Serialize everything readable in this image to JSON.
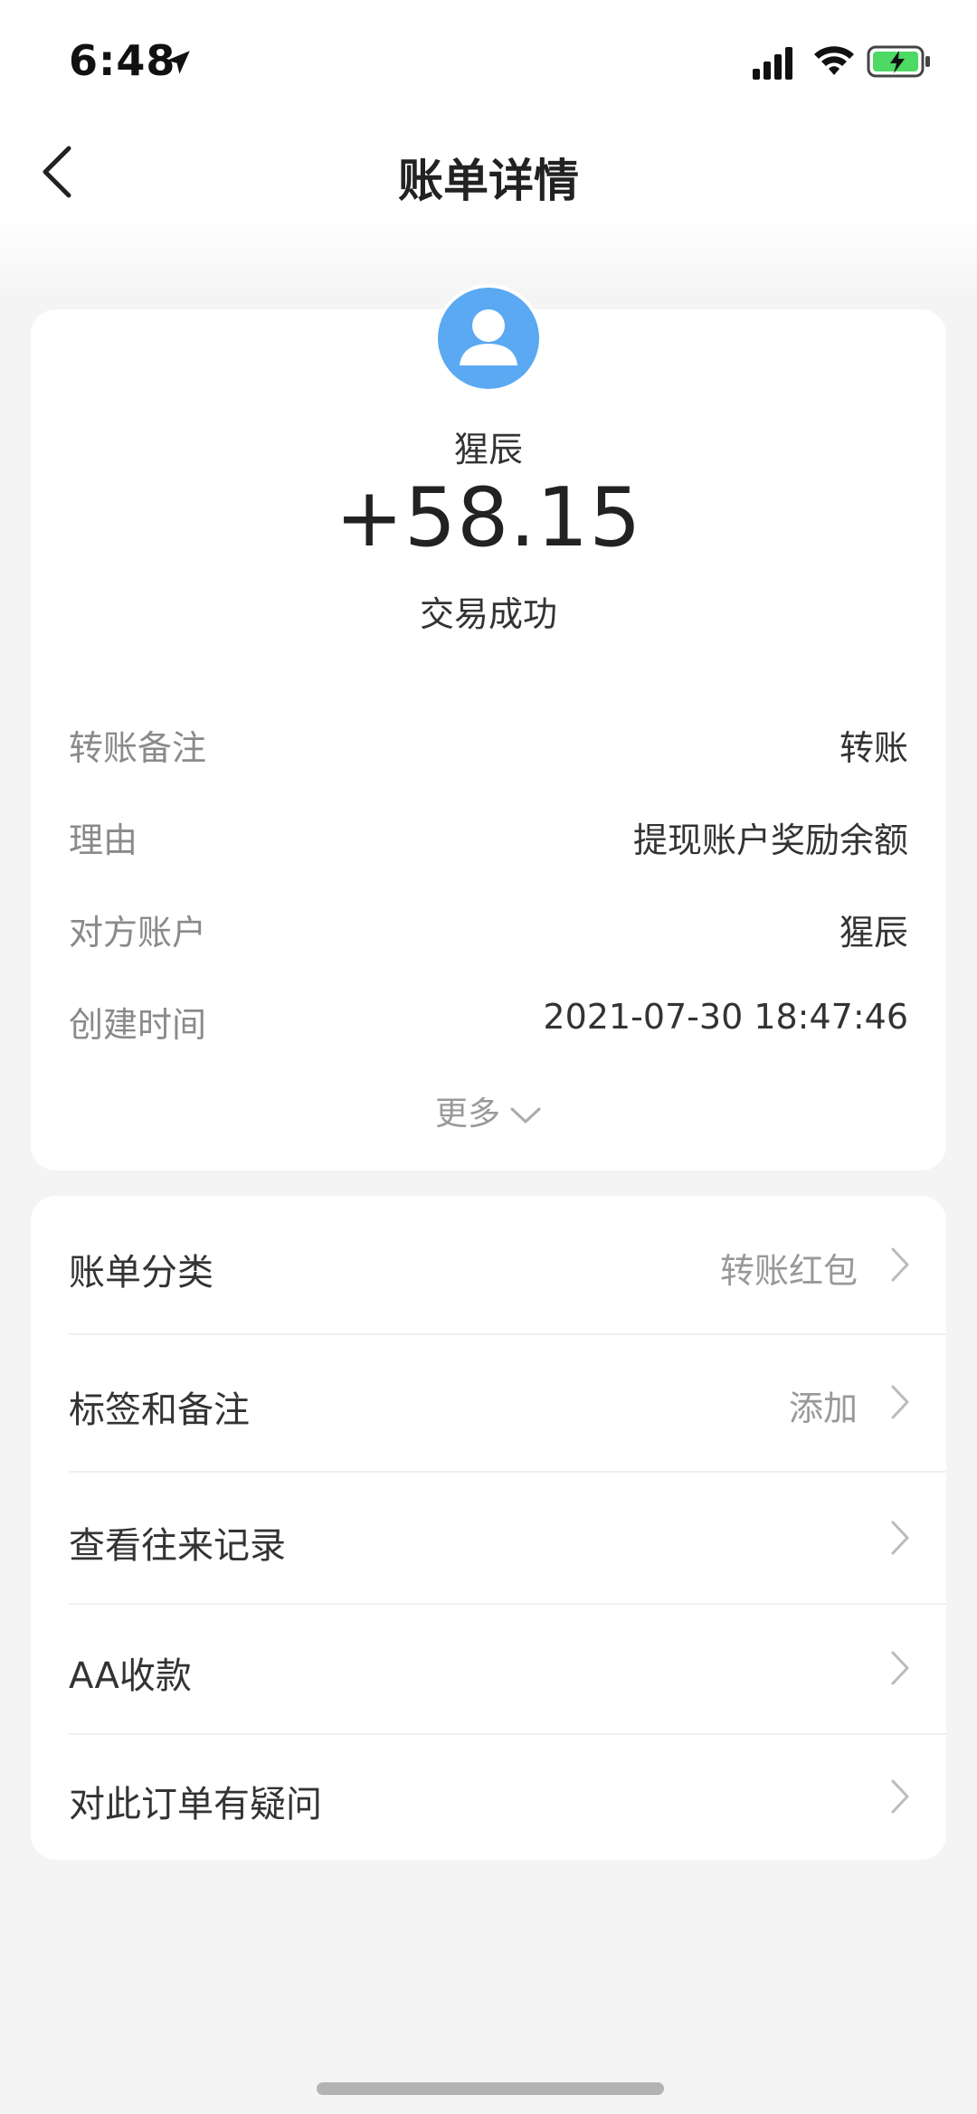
{
  "status_bar": {
    "time": "6:48"
  },
  "nav": {
    "title": "账单详情"
  },
  "transaction": {
    "payer_name": "猩辰",
    "amount": "+58.15",
    "status": "交易成功"
  },
  "details": [
    {
      "label": "转账备注",
      "value": "转账"
    },
    {
      "label": "理由",
      "value": "提现账户奖励余额"
    },
    {
      "label": "对方账户",
      "value": "猩辰"
    },
    {
      "label": "创建时间",
      "value": "2021-07-30 18:47:46"
    }
  ],
  "more_label": "更多",
  "menu": [
    {
      "label": "账单分类",
      "value": "转账红包"
    },
    {
      "label": "标签和备注",
      "value": "添加"
    },
    {
      "label": "查看往来记录",
      "value": ""
    },
    {
      "label": "AA收款",
      "value": ""
    },
    {
      "label": "对此订单有疑问",
      "value": ""
    }
  ],
  "colors": {
    "avatar": "#5aa9f2",
    "battery": "#4cd964"
  }
}
